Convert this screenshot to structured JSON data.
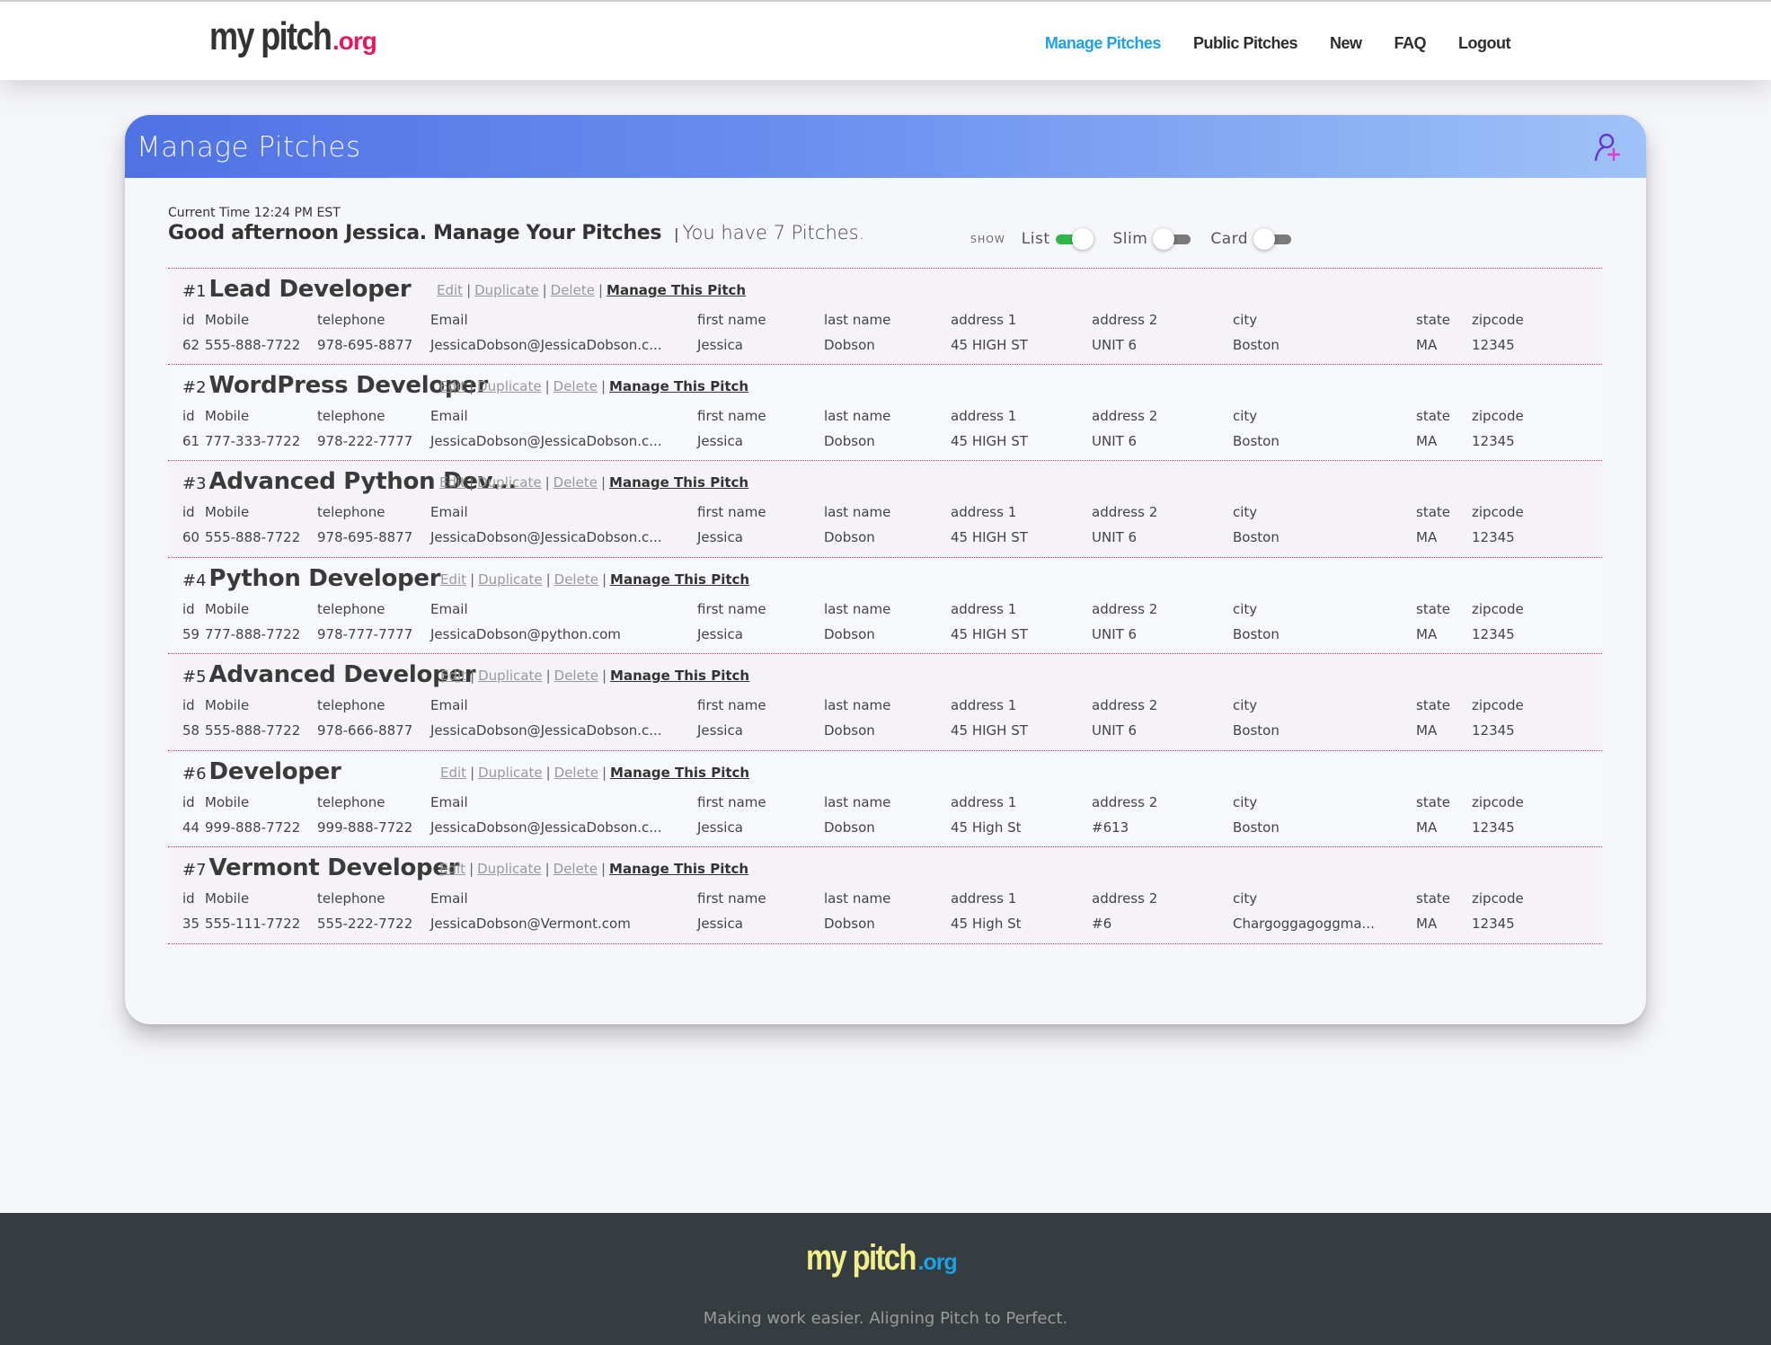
{
  "brand": {
    "word_a": "my",
    "word_b": "pitch",
    "tld": ".org"
  },
  "nav": {
    "items": [
      {
        "label": "Manage Pitches",
        "active": true
      },
      {
        "label": "Public Pitches",
        "active": false
      },
      {
        "label": "New",
        "active": false
      },
      {
        "label": "FAQ",
        "active": false
      },
      {
        "label": "Logout",
        "active": false
      }
    ]
  },
  "panel": {
    "title": "Manage Pitches",
    "add_icon": "add-user-icon",
    "current_time": "Current Time 12:24 PM EST",
    "greeting": "Good afternoon Jessica. Manage Your Pitches",
    "separator": "|",
    "count_text": "You have 7 Pitches.",
    "show": {
      "label": "SHOW",
      "toggles": [
        {
          "label": "List",
          "on": true
        },
        {
          "label": "Slim",
          "on": false
        },
        {
          "label": "Card",
          "on": false
        }
      ]
    }
  },
  "actions": {
    "edit": "Edit",
    "duplicate": "Duplicate",
    "delete": "Delete",
    "manage": "Manage This Pitch",
    "pipe": "|"
  },
  "columns": [
    "id",
    "Mobile",
    "telephone",
    "Email",
    "first name",
    "last name",
    "address 1",
    "address 2",
    "city",
    "state",
    "zipcode"
  ],
  "pitches": [
    {
      "num": "#1",
      "title": "Lead Developer",
      "values": [
        "62",
        "555-888-7722",
        "978-695-8877",
        "JessicaDobson@JessicaDobson.c...",
        "Jessica",
        "Dobson",
        "45 HIGH ST",
        "UNIT 6",
        "Boston",
        "MA",
        "12345"
      ]
    },
    {
      "num": "#2",
      "title": "WordPress Developer",
      "values": [
        "61",
        "777-333-7722",
        "978-222-7777",
        "JessicaDobson@JessicaDobson.c...",
        "Jessica",
        "Dobson",
        "45 HIGH ST",
        "UNIT 6",
        "Boston",
        "MA",
        "12345"
      ]
    },
    {
      "num": "#3",
      "title": "Advanced Python Dev...",
      "values": [
        "60",
        "555-888-7722",
        "978-695-8877",
        "JessicaDobson@JessicaDobson.c...",
        "Jessica",
        "Dobson",
        "45 HIGH ST",
        "UNIT 6",
        "Boston",
        "MA",
        "12345"
      ]
    },
    {
      "num": "#4",
      "title": "Python Developer",
      "values": [
        "59",
        "777-888-7722",
        "978-777-7777",
        "JessicaDobson@python.com",
        "Jessica",
        "Dobson",
        "45 HIGH ST",
        "UNIT 6",
        "Boston",
        "MA",
        "12345"
      ]
    },
    {
      "num": "#5",
      "title": "Advanced Developer",
      "values": [
        "58",
        "555-888-7722",
        "978-666-8877",
        "JessicaDobson@JessicaDobson.c...",
        "Jessica",
        "Dobson",
        "45 HIGH ST",
        "UNIT 6",
        "Boston",
        "MA",
        "12345"
      ]
    },
    {
      "num": "#6",
      "title": "Developer",
      "values": [
        "44",
        "999-888-7722",
        "999-888-7722",
        "JessicaDobson@JessicaDobson.c...",
        "Jessica",
        "Dobson",
        "45 High St",
        "#613",
        "Boston",
        "MA",
        "12345"
      ]
    },
    {
      "num": "#7",
      "title": "Vermont Developer",
      "values": [
        "35",
        "555-111-7722",
        "555-222-7722",
        "JessicaDobson@Vermont.com",
        "Jessica",
        "Dobson",
        "45 High St",
        "#6",
        "Chargoggagoggma...",
        "MA",
        "12345"
      ]
    }
  ],
  "footer": {
    "word_a": "my",
    "word_b": "pitch",
    "tld": ".org",
    "tagline": "Making work easier. Aligning Pitch to Perfect."
  },
  "colors": {
    "accent": "#1aa3e6",
    "brand_pink": "#e8175d",
    "toggle_on": "#2fb84a",
    "divider": "#e0306a",
    "footer_bg": "#353d40",
    "footer_logo": "#f1ef8a"
  }
}
